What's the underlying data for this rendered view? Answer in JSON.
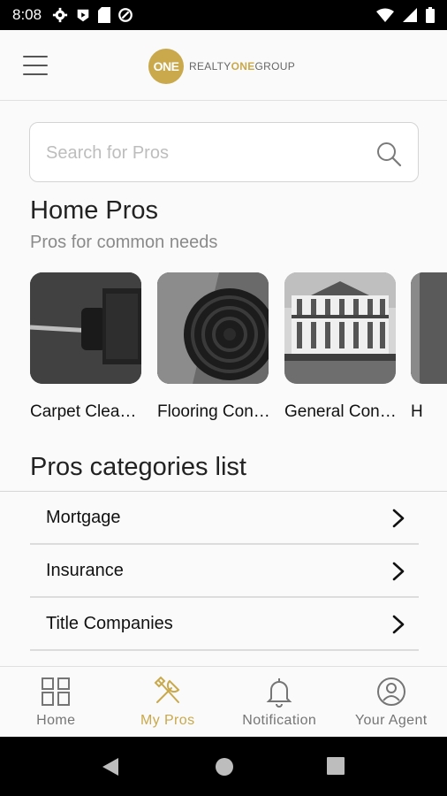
{
  "status_bar": {
    "time": "8:08"
  },
  "header": {
    "logo_mark": "ONE",
    "logo_text_realty": "REALTY",
    "logo_text_one": "ONE",
    "logo_text_group": "GROUP"
  },
  "search": {
    "placeholder": "Search for Pros",
    "value": ""
  },
  "home_pros": {
    "title": "Home Pros",
    "subtitle": "Pros for common needs",
    "cards": [
      {
        "label": "Carpet Clea…",
        "image": "carpet-cleaner-photo"
      },
      {
        "label": "Flooring Con…",
        "image": "rolled-carpet-photo"
      },
      {
        "label": "General Con…",
        "image": "house-photo"
      },
      {
        "label": "H",
        "image": "partial-photo"
      }
    ]
  },
  "categories": {
    "title": "Pros categories list",
    "items": [
      {
        "label": "Mortgage"
      },
      {
        "label": "Insurance"
      },
      {
        "label": "Title Companies"
      }
    ]
  },
  "bottom_nav": {
    "items": [
      {
        "label": "Home",
        "icon": "home-grid-icon",
        "active": false
      },
      {
        "label": "My Pros",
        "icon": "tools-icon",
        "active": true
      },
      {
        "label": "Notification",
        "icon": "bell-icon",
        "active": false
      },
      {
        "label": "Your Agent",
        "icon": "agent-icon",
        "active": false
      }
    ]
  },
  "colors": {
    "accent": "#c9a94b",
    "text": "#212121",
    "muted": "#8a8a8a"
  }
}
